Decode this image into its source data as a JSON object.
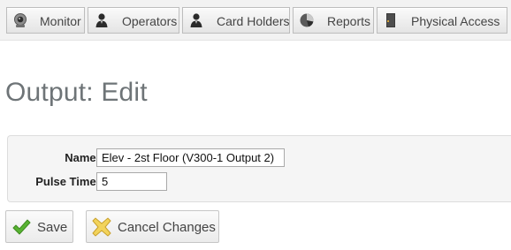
{
  "nav": {
    "monitor": {
      "label": "Monitor",
      "icon": "webcam-icon"
    },
    "operators": {
      "label": "Operators",
      "icon": "user-icon"
    },
    "card_holders": {
      "label": "Card Holders",
      "icon": "user-icon"
    },
    "reports": {
      "label": "Reports",
      "icon": "pie-chart-icon"
    },
    "physical_access": {
      "label": "Physical Access",
      "icon": "door-icon"
    }
  },
  "page": {
    "title": "Output: Edit"
  },
  "form": {
    "name": {
      "label": "Name:",
      "value": "Elev - 2st Floor (V300-1 Output 2)"
    },
    "pulse_time": {
      "label": "Pulse Time:",
      "value": "5"
    }
  },
  "actions": {
    "save": {
      "label": "Save",
      "icon": "checkmark-icon",
      "color": "#4caf2a"
    },
    "cancel": {
      "label": "Cancel Changes",
      "icon": "cancel-x-icon",
      "color": "#e8c84a"
    }
  }
}
